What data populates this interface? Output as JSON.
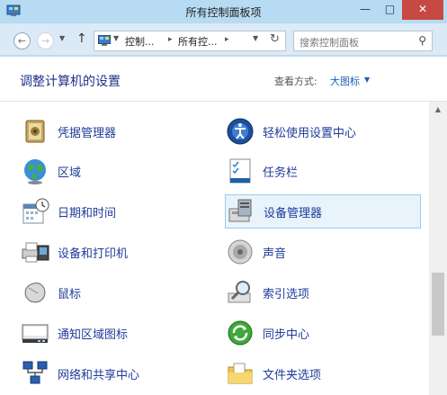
{
  "window": {
    "title": "所有控制面板项",
    "minimize": "—",
    "maximize": "□",
    "close": "✕"
  },
  "nav": {
    "back": "←",
    "forward": "→",
    "recent": "▼",
    "up": "↑",
    "breadcrumbs": [
      "控制...",
      "所有控..."
    ],
    "sep": "▸",
    "dropdown": "▼",
    "refresh": "↻",
    "search_placeholder": "搜索控制面板",
    "search_icon": "⚲"
  },
  "pane": {
    "title": "调整计算机的设置",
    "view_label": "查看方式:",
    "view_value": "大图标",
    "view_arrow": "▼"
  },
  "items": [
    {
      "label": "凭据管理器",
      "icon": "credential-manager-icon",
      "column": 1
    },
    {
      "label": "轻松使用设置中心",
      "icon": "ease-of-access-icon",
      "column": 2
    },
    {
      "label": "区域",
      "icon": "region-globe-icon",
      "column": 1
    },
    {
      "label": "任务栏",
      "icon": "taskbar-icon",
      "column": 2
    },
    {
      "label": "日期和时间",
      "icon": "date-time-icon",
      "column": 1
    },
    {
      "label": "设备管理器",
      "icon": "device-manager-icon",
      "column": 2,
      "selected": true
    },
    {
      "label": "设备和打印机",
      "icon": "devices-printers-icon",
      "column": 1
    },
    {
      "label": "声音",
      "icon": "sound-speaker-icon",
      "column": 2
    },
    {
      "label": "鼠标",
      "icon": "mouse-icon",
      "column": 1
    },
    {
      "label": "索引选项",
      "icon": "indexing-options-icon",
      "column": 2
    },
    {
      "label": "通知区域图标",
      "icon": "notification-area-icon",
      "column": 1
    },
    {
      "label": "同步中心",
      "icon": "sync-center-icon",
      "column": 2
    },
    {
      "label": "网络和共享中心",
      "icon": "network-sharing-icon",
      "column": 1
    },
    {
      "label": "文件夹选项",
      "icon": "folder-options-icon",
      "column": 2
    }
  ]
}
